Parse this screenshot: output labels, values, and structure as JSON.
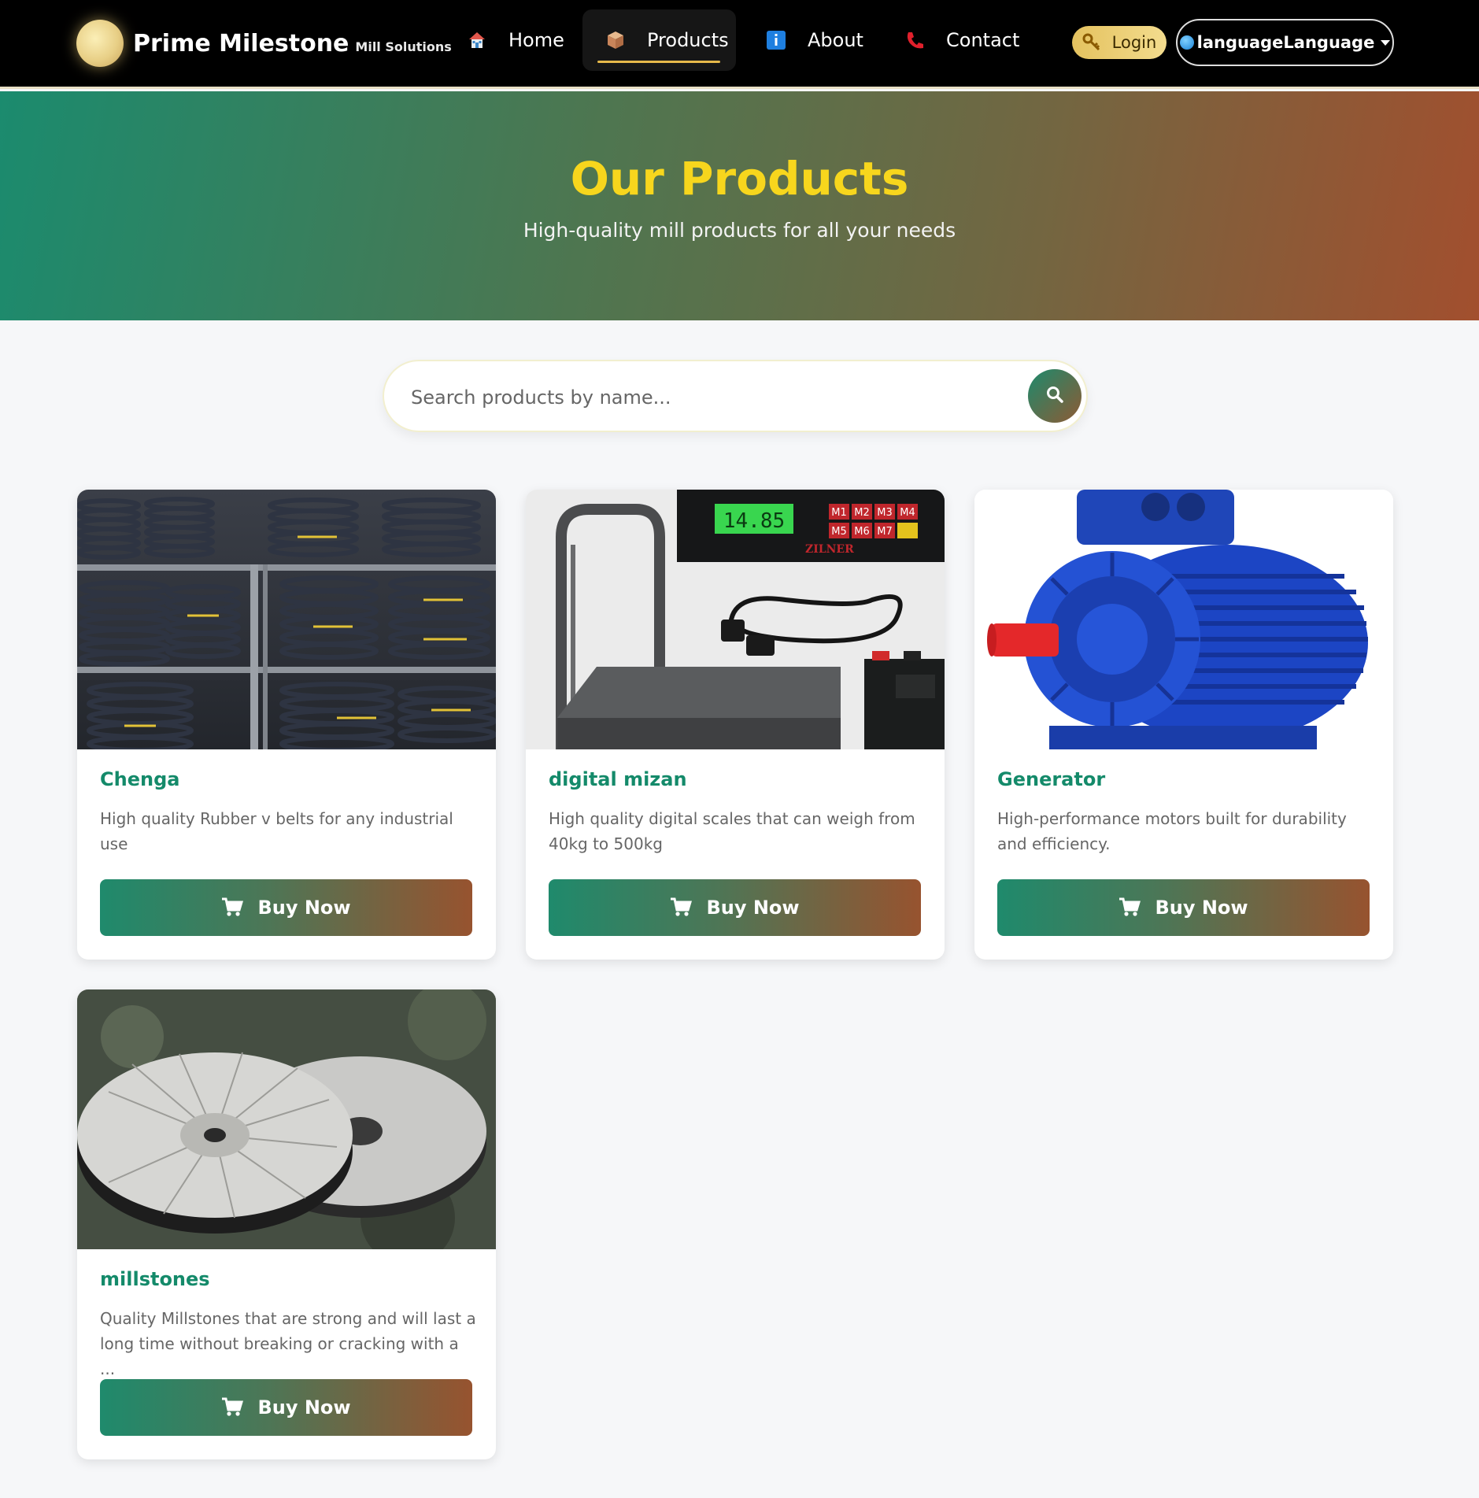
{
  "brand": {
    "name": "Prime Milestone",
    "subtitle": "Mill Solutions"
  },
  "nav": {
    "items": [
      {
        "label": "Home",
        "icon": "house-icon"
      },
      {
        "label": "Products",
        "icon": "package-icon",
        "active": true
      },
      {
        "label": "About",
        "icon": "info-icon"
      },
      {
        "label": "Contact",
        "icon": "phone-icon"
      }
    ],
    "login_label": "Login",
    "language_label": "languageLanguage"
  },
  "hero": {
    "title": "Our Products",
    "subtitle": "High-quality mill products for all your needs"
  },
  "search": {
    "placeholder": "Search products by name...",
    "value": ""
  },
  "products": [
    {
      "title": "Chenga",
      "description": "High quality Rubber v belts for any industrial use",
      "button": "Buy Now"
    },
    {
      "title": "digital mizan",
      "description": "High quality digital scales that can weigh from 40kg to 500kg",
      "button": "Buy Now"
    },
    {
      "title": "Generator",
      "description": "High-performance motors built for durability and efficiency.",
      "button": "Buy Now"
    },
    {
      "title": "millstones",
      "description": "Quality Millstones that are strong and will last a long time without breaking or cracking with a ...",
      "button": "Buy Now"
    }
  ],
  "colors": {
    "accent_green": "#148a6a",
    "accent_rust": "#a24f2e",
    "hero_title": "#f7d61d",
    "login_gold": "#e4c25f"
  },
  "scale_display": "14.85",
  "scale_brand": "ZILNER",
  "scale_keys": [
    "M1",
    "M2",
    "M3",
    "M4",
    "M5",
    "M6",
    "M7"
  ]
}
